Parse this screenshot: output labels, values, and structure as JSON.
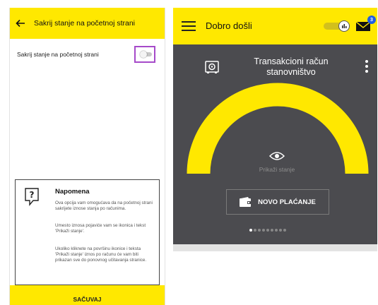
{
  "left": {
    "header": {
      "title": "Sakrij stanje na početnoj strani",
      "back_icon": "arrow-left-icon"
    },
    "setting": {
      "label": "Sakrij stanje na početnoj strani",
      "toggle_on": false,
      "highlight_color": "#a64ac9"
    },
    "note": {
      "title": "Napomena",
      "icon": "question-bubble-icon",
      "paragraphs": [
        "Ova opcija vam omogućava da na početnoj strani sakrijete iznose stanja po računima.",
        "Umesto iznosa pojaviće vam se ikonica i tekst 'Prikaži stanje'.",
        "Ukoliko kliknete na površinu ikonice i teksta 'Prikaži stanje' iznos po računu će vam biti prikazan sve do ponovnog učitavanja stranice."
      ]
    },
    "save_label": "SAČUVAJ"
  },
  "right": {
    "header": {
      "title": "Dobro došli",
      "menu_icon": "hamburger-icon",
      "mail_icon": "envelope-icon",
      "badge_count": "3"
    },
    "account": {
      "title_line1": "Transakcioni račun",
      "title_line2": "stanovništvo",
      "icon": "safe-icon"
    },
    "show_balance_label": "Prikaži stanje",
    "new_payment_label": "NOVO PLAĆANJE",
    "pagination": {
      "total": 9,
      "active": 1
    }
  },
  "colors": {
    "brand_yellow": "#ffe800",
    "card_gray": "#4b4b4f",
    "badge_blue": "#1e5ee6"
  }
}
